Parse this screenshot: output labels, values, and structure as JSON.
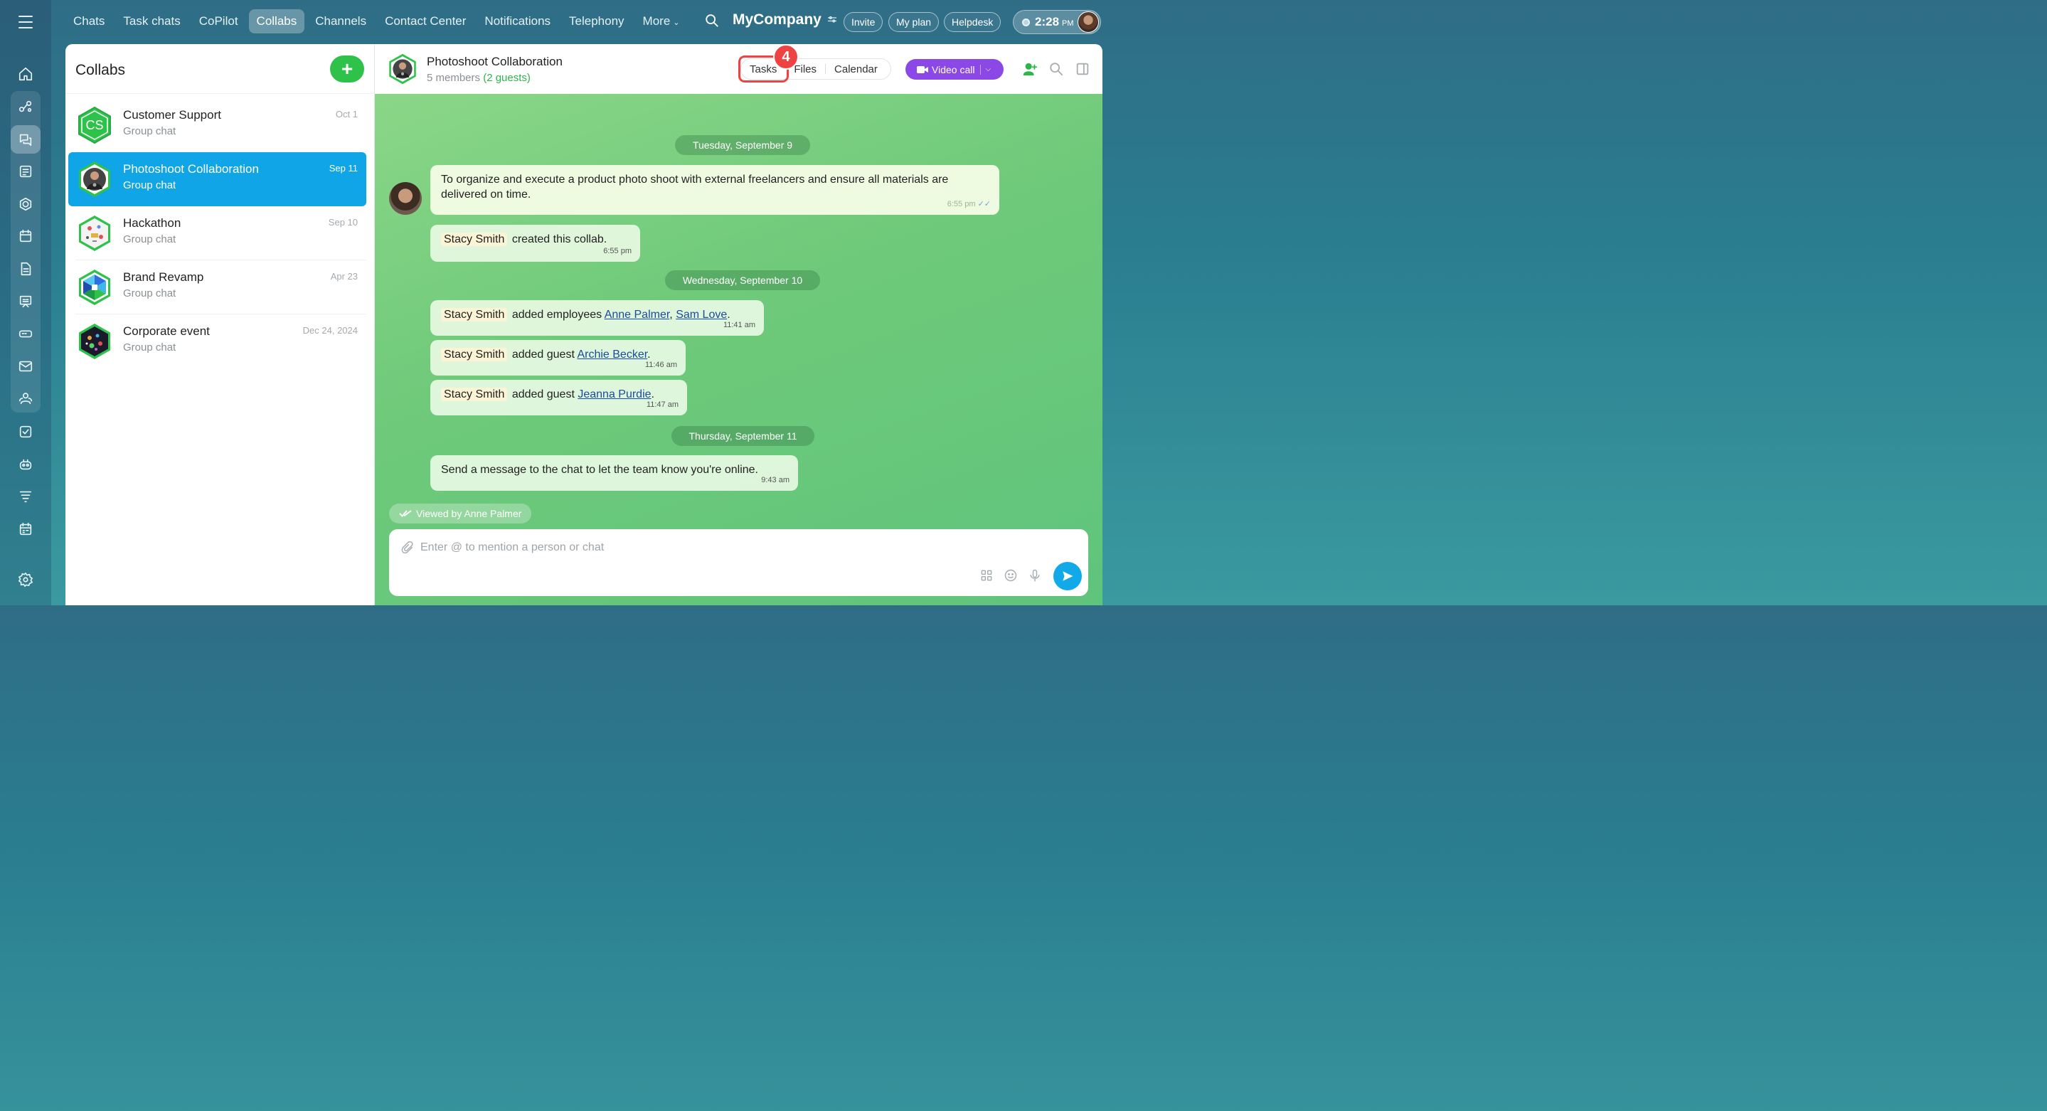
{
  "topnav": {
    "tabs": [
      {
        "label": "Chats"
      },
      {
        "label": "Task chats"
      },
      {
        "label": "CoPilot"
      },
      {
        "label": "Collabs"
      },
      {
        "label": "Channels"
      },
      {
        "label": "Contact Center"
      },
      {
        "label": "Notifications"
      },
      {
        "label": "Telephony"
      },
      {
        "label": "More"
      }
    ],
    "company": "MyCompany",
    "invite": "Invite",
    "my_plan": "My plan",
    "helpdesk": "Helpdesk",
    "time": "2:28",
    "ampm": "PM"
  },
  "sidebar": {
    "icons": [
      "home-icon",
      "collab-icon",
      "chat-icon",
      "feed-icon",
      "crm-icon",
      "calendar-icon",
      "document-icon",
      "board-icon",
      "storage-icon",
      "mail-icon",
      "contacts-icon",
      "tasks-icon",
      "copilot-icon",
      "filter-icon",
      "schedule-icon",
      "settings-icon"
    ]
  },
  "left": {
    "title": "Collabs",
    "chats": [
      {
        "name": "Customer Support",
        "sub": "Group chat",
        "date": "Oct 1",
        "initials": "CS"
      },
      {
        "name": "Photoshoot Collaboration",
        "sub": "Group chat",
        "date": "Sep 11"
      },
      {
        "name": "Hackathon",
        "sub": "Group chat",
        "date": "Sep 10"
      },
      {
        "name": "Brand Revamp",
        "sub": "Group chat",
        "date": "Apr 23"
      },
      {
        "name": "Corporate event",
        "sub": "Group chat",
        "date": "Dec 24, 2024"
      }
    ]
  },
  "chat": {
    "title": "Photoshoot Collaboration",
    "members": "5 members",
    "guests": "(2 guests)",
    "tabs": {
      "tasks": "Tasks",
      "files": "Files",
      "calendar": "Calendar"
    },
    "step_badge": "4",
    "video_call": "Video call",
    "messages": {
      "date1": "Tuesday, September 9",
      "goal": "To organize and execute a product photo shoot with external freelancers and ensure all materials are delivered on time.",
      "goal_time": "6:55 pm",
      "m1_name": "Stacy Smith",
      "m1_text": "created this collab.",
      "m1_time": "6:55 pm",
      "date2": "Wednesday, September 10",
      "m2_name": "Stacy Smith",
      "m2_text": "added employees",
      "m2_link1": "Anne Palmer",
      "m2_comma": ",",
      "m2_link2": "Sam Love",
      "m2_end": ".",
      "m2_time": "11:41 am",
      "m3_name": "Stacy Smith",
      "m3_text": "added guest",
      "m3_link": "Archie Becker",
      "m3_end": ".",
      "m3_time": "11:46 am",
      "m4_name": "Stacy Smith",
      "m4_text": "added guest",
      "m4_link": "Jeanna Purdie",
      "m4_end": ".",
      "m4_time": "11:47 am",
      "date3": "Thursday, September 11",
      "m5_text": "Send a message to the chat to let the team know you're online.",
      "m5_time": "9:43 am"
    },
    "viewed_by": "Viewed by Anne Palmer",
    "composer_placeholder": "Enter @ to mention a person or chat"
  },
  "colors": {
    "accent": "#10a5e6",
    "add_button": "#2fc24b",
    "video_call": "#8c48e6",
    "highlight": "#ef4343",
    "guests": "#2fb54a"
  }
}
